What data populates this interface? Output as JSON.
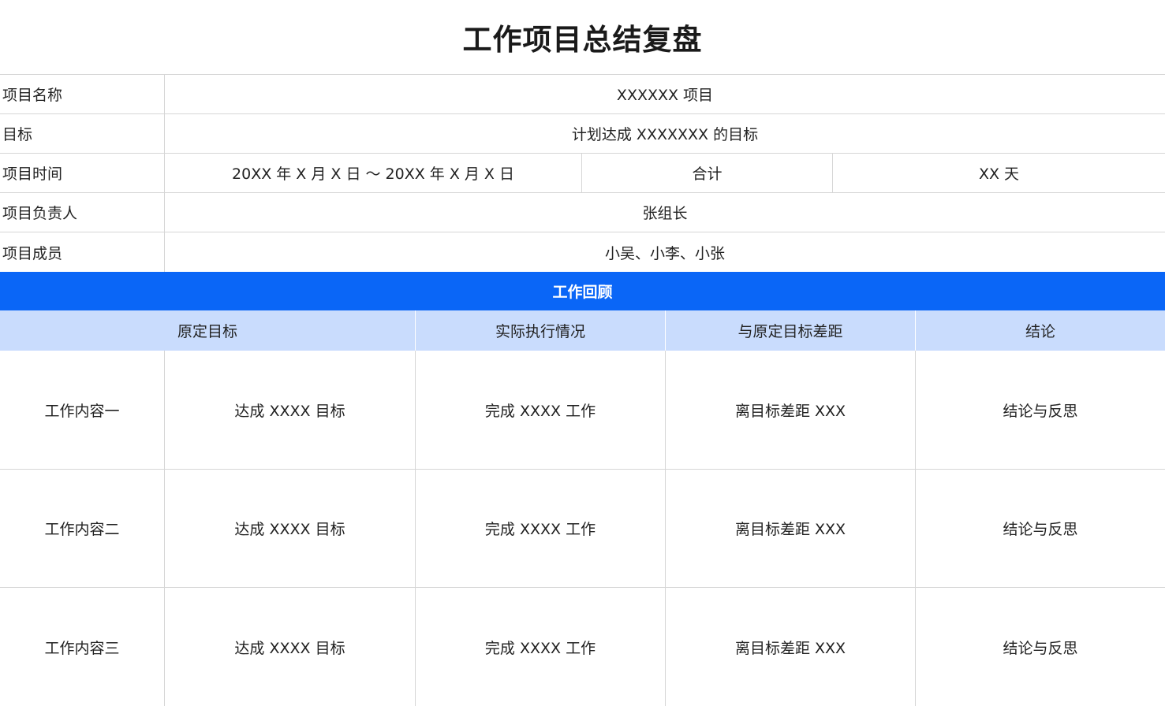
{
  "title": "工作项目总结复盘",
  "info": {
    "project_name_label": "项目名称",
    "project_name_value": "XXXXXX 项目",
    "goal_label": "目标",
    "goal_value": "计划达成 XXXXXXX 的目标",
    "time_label": "项目时间",
    "time_value": "20XX 年 X 月 X 日 ～ 20XX 年 X 月 X 日",
    "total_label": "合计",
    "total_value": "XX 天",
    "owner_label": "项目负责人",
    "owner_value": "张组长",
    "members_label": "项目成员",
    "members_value": "小吴、小李、小张"
  },
  "review": {
    "section_title": "工作回顾",
    "headers": [
      "原定目标",
      "实际执行情况",
      "与原定目标差距",
      "结论"
    ],
    "rows": [
      {
        "name": "工作内容一",
        "target": "达成 XXXX 目标",
        "actual": "完成 XXXX 工作",
        "gap": "离目标差距 XXX",
        "conclusion": "结论与反思"
      },
      {
        "name": "工作内容二",
        "target": "达成 XXXX 目标",
        "actual": "完成 XXXX 工作",
        "gap": "离目标差距 XXX",
        "conclusion": "结论与反思"
      },
      {
        "name": "工作内容三",
        "target": "达成 XXXX 目标",
        "actual": "完成 XXXX 工作",
        "gap": "离目标差距 XXX",
        "conclusion": "结论与反思"
      }
    ]
  },
  "colors": {
    "section_bar": "#0a66f7",
    "subheader": "#c9dcfd",
    "grid": "#d6d6d6"
  }
}
